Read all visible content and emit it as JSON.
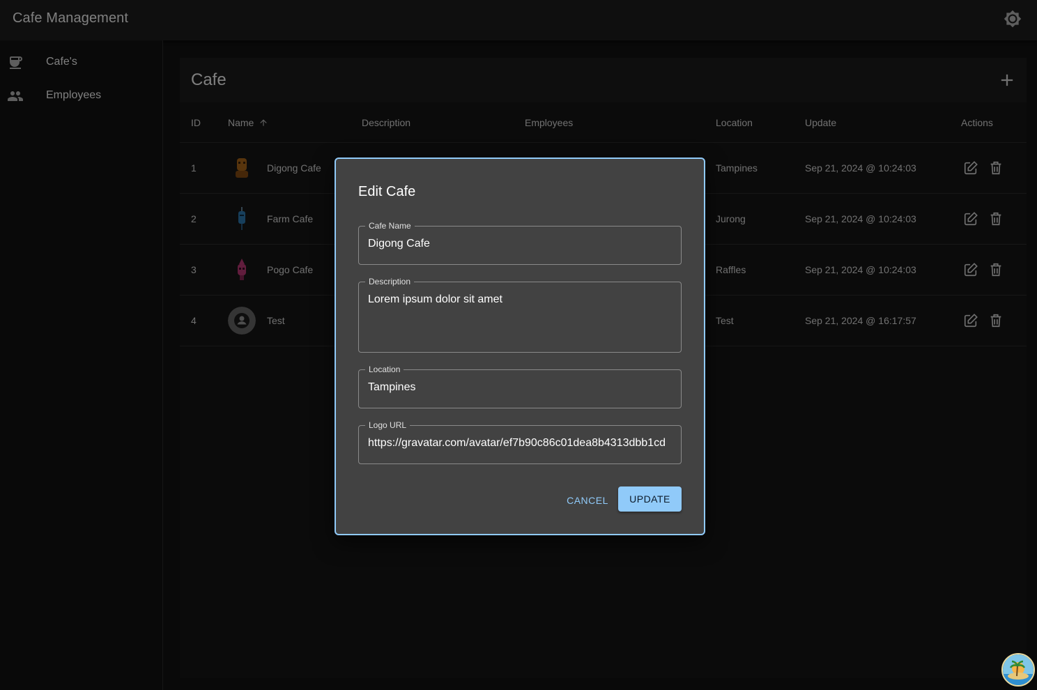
{
  "app": {
    "title": "Cafe Management"
  },
  "sidebar": {
    "items": [
      {
        "label": "Cafe's",
        "icon": "coffee-icon"
      },
      {
        "label": "Employees",
        "icon": "people-icon"
      }
    ]
  },
  "card": {
    "title": "Cafe"
  },
  "table": {
    "headers": {
      "id": "ID",
      "name": "Name",
      "description": "Description",
      "employees": "Employees",
      "location": "Location",
      "update": "Update",
      "actions": "Actions"
    },
    "rows": [
      {
        "id": "1",
        "name": "Digong Cafe",
        "location": "Tampines",
        "update": "Sep 21, 2024 @ 10:24:03"
      },
      {
        "id": "2",
        "name": "Farm Cafe",
        "location": "Jurong",
        "update": "Sep 21, 2024 @ 10:24:03"
      },
      {
        "id": "3",
        "name": "Pogo Cafe",
        "location": "Raffles",
        "update": "Sep 21, 2024 @ 10:24:03"
      },
      {
        "id": "4",
        "name": "Test",
        "location": "Test",
        "update": "Sep 21, 2024 @ 16:17:57"
      }
    ]
  },
  "dialog": {
    "title": "Edit Cafe",
    "fields": {
      "name": {
        "label": "Cafe Name",
        "value": "Digong Cafe"
      },
      "description": {
        "label": "Description",
        "value": "Lorem ipsum dolor sit amet"
      },
      "location": {
        "label": "Location",
        "value": "Tampines"
      },
      "logo": {
        "label": "Logo URL",
        "value": "https://gravatar.com/avatar/ef7b90c86c01dea8b4313dbb1cd"
      }
    },
    "cancel_label": "CANCEL",
    "update_label": "UPDATE"
  },
  "colors": {
    "accent": "#90caf9",
    "appbar": "#1e1e1e",
    "dialog": "#424242"
  }
}
